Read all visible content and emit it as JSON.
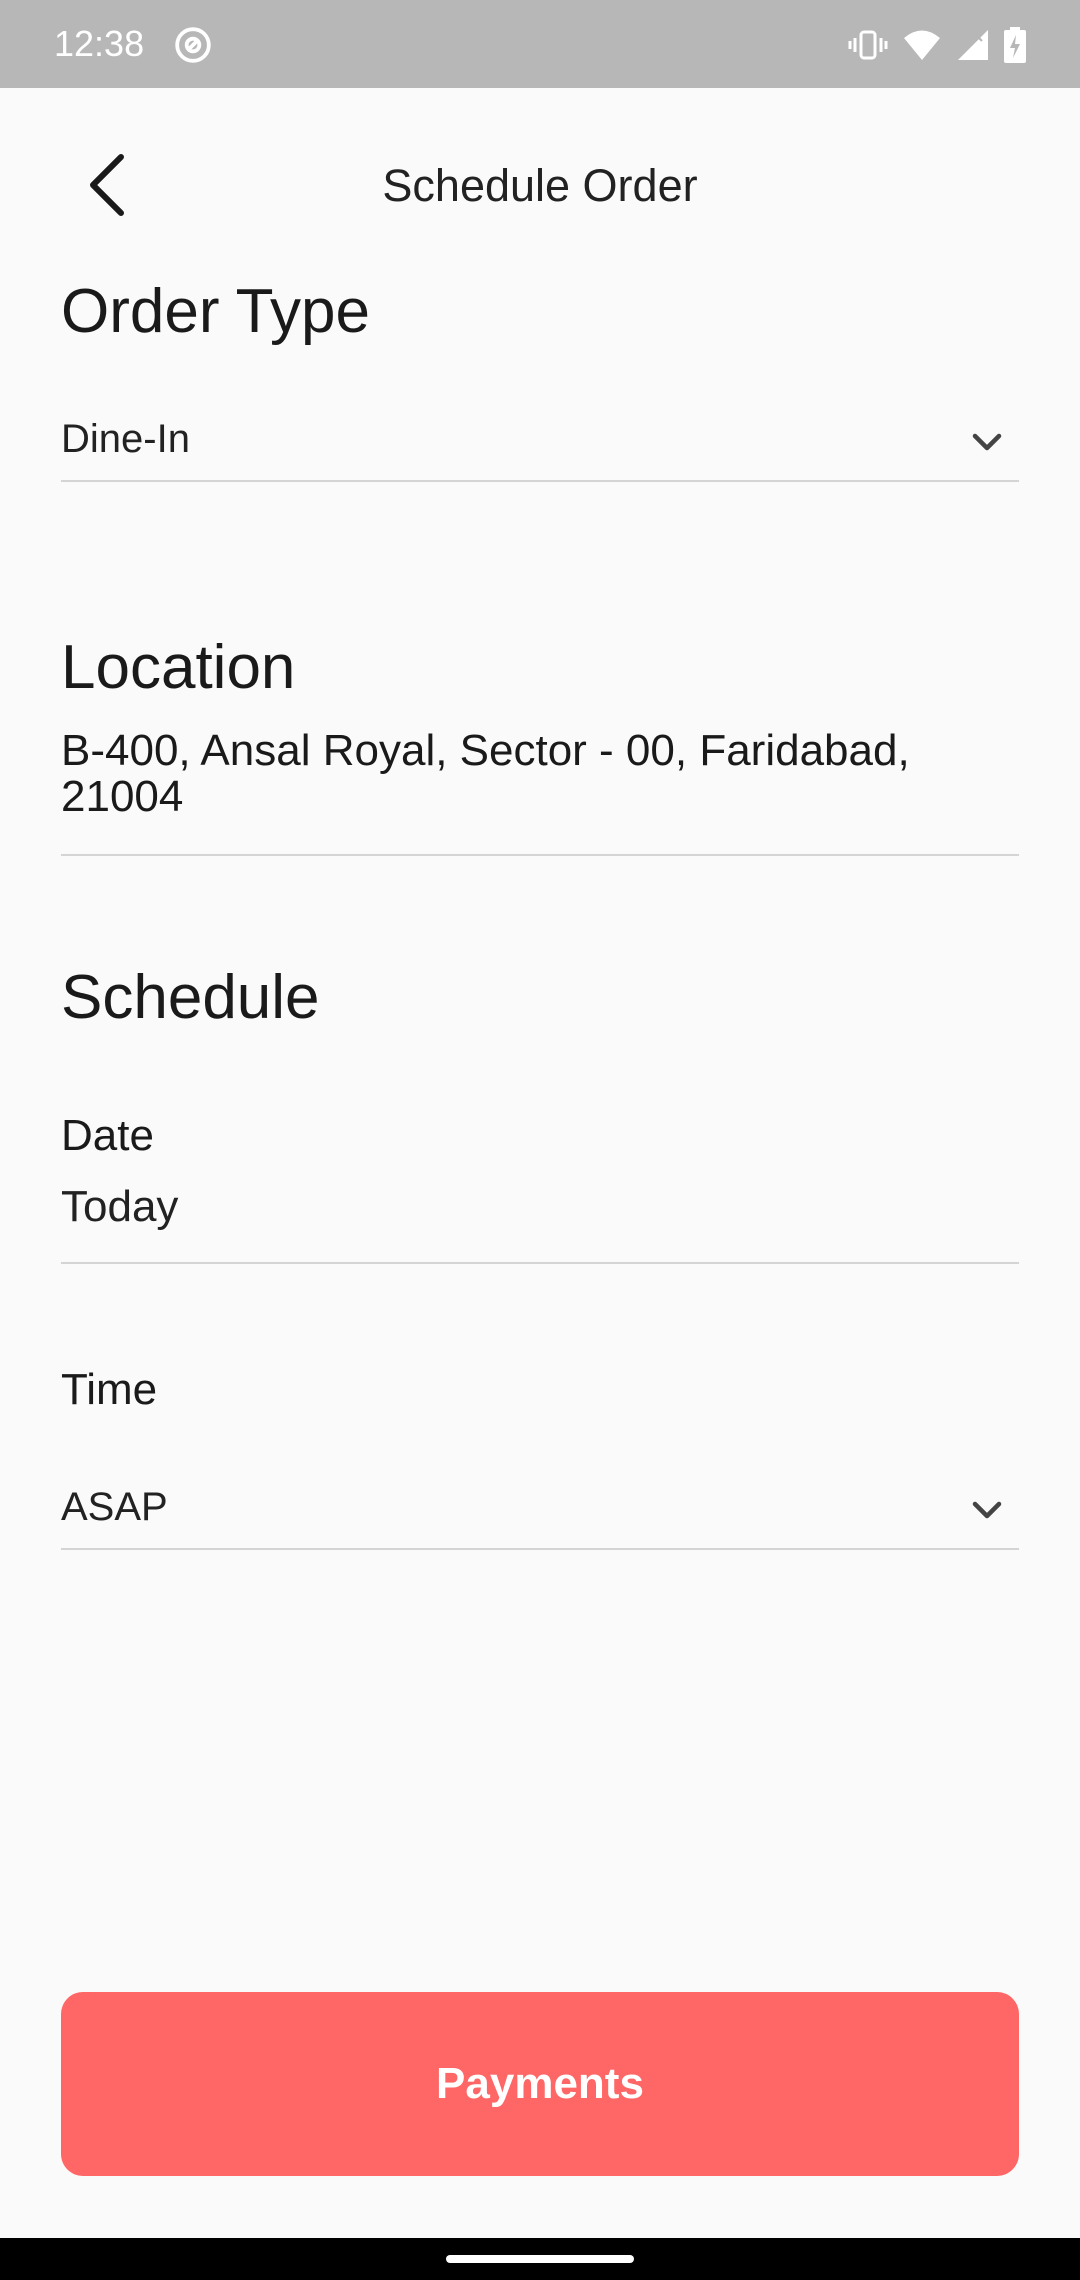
{
  "status_bar": {
    "time": "12:38",
    "icons": [
      "at-sign-icon",
      "vibrate-icon",
      "wifi-icon",
      "signal-icon",
      "battery-charging-icon"
    ]
  },
  "header": {
    "title": "Schedule Order",
    "back_icon": "chevron-left-icon"
  },
  "order_type": {
    "heading": "Order Type",
    "selected": "Dine-In",
    "icon": "chevron-down-icon"
  },
  "location": {
    "heading": "Location",
    "address": "B-400, Ansal Royal, Sector - 00, Faridabad, 21004"
  },
  "schedule": {
    "heading": "Schedule",
    "date_label": "Date",
    "date_value": "Today",
    "time_label": "Time",
    "time_value": "ASAP"
  },
  "actions": {
    "payments_label": "Payments"
  },
  "colors": {
    "status_bar": "#b7b7b7",
    "background": "#fafafa",
    "accent_button": "#ff6666",
    "divider": "#d4d4d4"
  }
}
